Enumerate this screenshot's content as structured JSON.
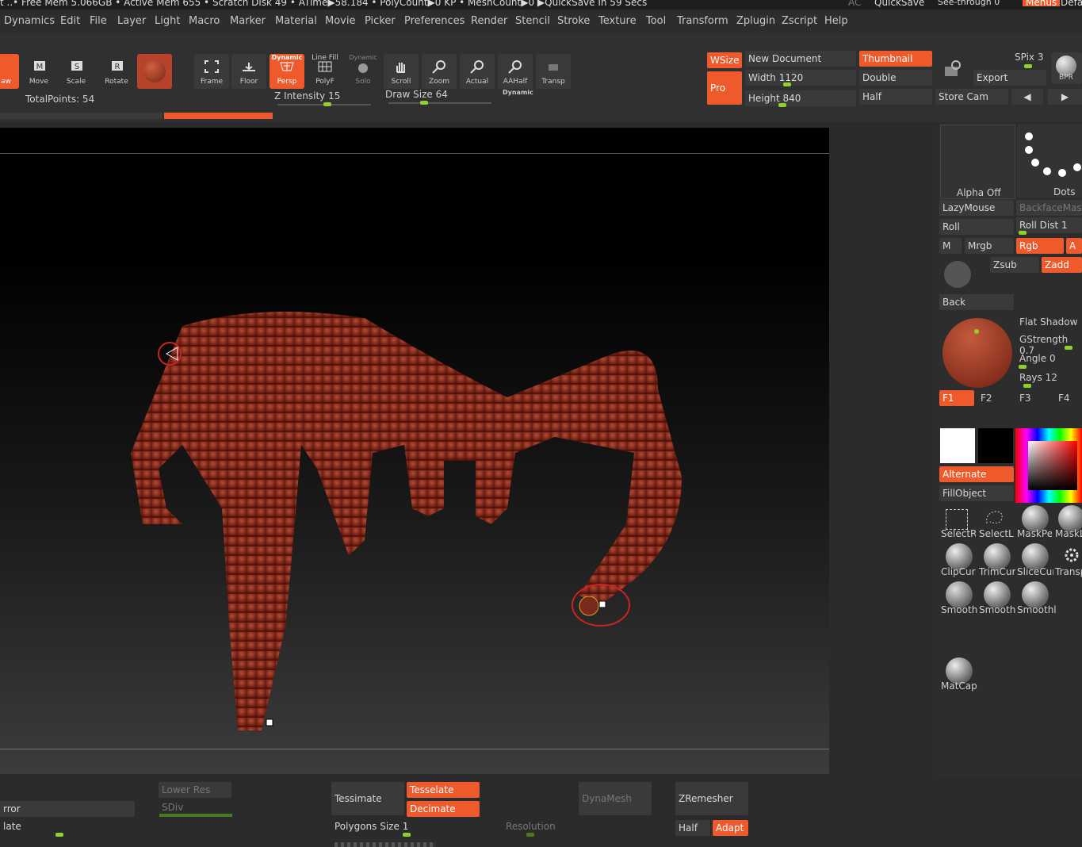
{
  "status": {
    "text": "t  ..• Free Mem 5.066GB • Active Mem 655 • Scratch Disk 49 •  ATime▶58.184 • PolyCount▶0 KP  • MeshCount▶0  ▶QuickSave In 59 Secs",
    "ac": "AC",
    "quicksave": "QuickSave",
    "seethrough": "See-through  0",
    "menus": "Menus",
    "default": "Defa"
  },
  "menu": [
    "Dynamics",
    "Edit",
    "File",
    "Layer",
    "Light",
    "Macro",
    "Marker",
    "Material",
    "Movie",
    "Picker",
    "Preferences",
    "Render",
    "Stencil",
    "Stroke",
    "Texture",
    "Tool",
    "Transform",
    "Zplugin",
    "Zscript",
    "Help"
  ],
  "toolbar": {
    "draw": "aw",
    "move": "Move",
    "scale": "Scale",
    "rotate": "Rotate",
    "frame": "Frame",
    "floor": "Floor",
    "persp_top": "Dynamic",
    "persp": "Persp",
    "polyf_top": "Line Fill",
    "polyf": "PolyF",
    "solo_top": "Dynamic",
    "solo": "Solo",
    "scroll": "Scroll",
    "zoom": "Zoom",
    "actual": "Actual",
    "aahalf": "AAHalf",
    "dynamic": "Dynamic",
    "transp": "Transp",
    "totalpoints": "TotalPoints: 54",
    "zintensity_label": "Z Intensity",
    "zintensity_value": "15",
    "drawsize_label": "Draw Size",
    "drawsize_value": "64",
    "wsize": "WSize",
    "pro": "Pro",
    "new_document": "New Document",
    "width_label": "Width",
    "width_value": "1120",
    "height_label": "Height",
    "height_value": "840",
    "thumbnail": "Thumbnail",
    "double": "Double",
    "half": "Half",
    "export": "Export",
    "store_cam": "Store Cam",
    "spix": "SPix 3",
    "bpr": "BPR"
  },
  "right": {
    "alpha_off": "Alpha Off",
    "dots": "Dots",
    "lazymouse": "LazyMouse",
    "backfacemask": "BackfaceMask",
    "roll": "Roll",
    "roll_dist": "Roll Dist 1",
    "m": "M",
    "mrgb": "Mrgb",
    "rgb": "Rgb",
    "a": "A",
    "zsub": "Zsub",
    "zadd": "Zadd",
    "back": "Back",
    "flat_shadow": "Flat Shadow",
    "gstrength": "GStrength 0.7",
    "angle": "Angle 0",
    "rays": "Rays 12",
    "f1": "F1",
    "f2": "F2",
    "f3": "F3",
    "f4": "F4",
    "alternate": "Alternate",
    "fillobject": "FillObject",
    "tools1": [
      "SelectRe",
      "SelectLa",
      "MaskPe",
      "MaskL"
    ],
    "tools2": [
      "ClipCurv",
      "TrimCur",
      "SliceCur",
      "Transp"
    ],
    "tools3": [
      "Smooth",
      "Smooth",
      "Smoothl"
    ],
    "matcap": "MatCap"
  },
  "bottom": {
    "error": "rror",
    "late": "late",
    "lower_res": "Lower Res",
    "sdiv": "SDiv",
    "tessimate": "Tessimate",
    "tesselate": "Tesselate",
    "decimate": "Decimate",
    "polygons_size": "Polygons Size",
    "polygons_size_value": "1",
    "dynamesh": "DynaMesh",
    "resolution": "Resolution",
    "zremesher": "ZRemesher",
    "half": "Half",
    "adapt": "Adapt"
  },
  "colors": {
    "accent": "#ee5a2b",
    "slider_knob": "#8fd12b",
    "model": "#8b2a1c"
  }
}
